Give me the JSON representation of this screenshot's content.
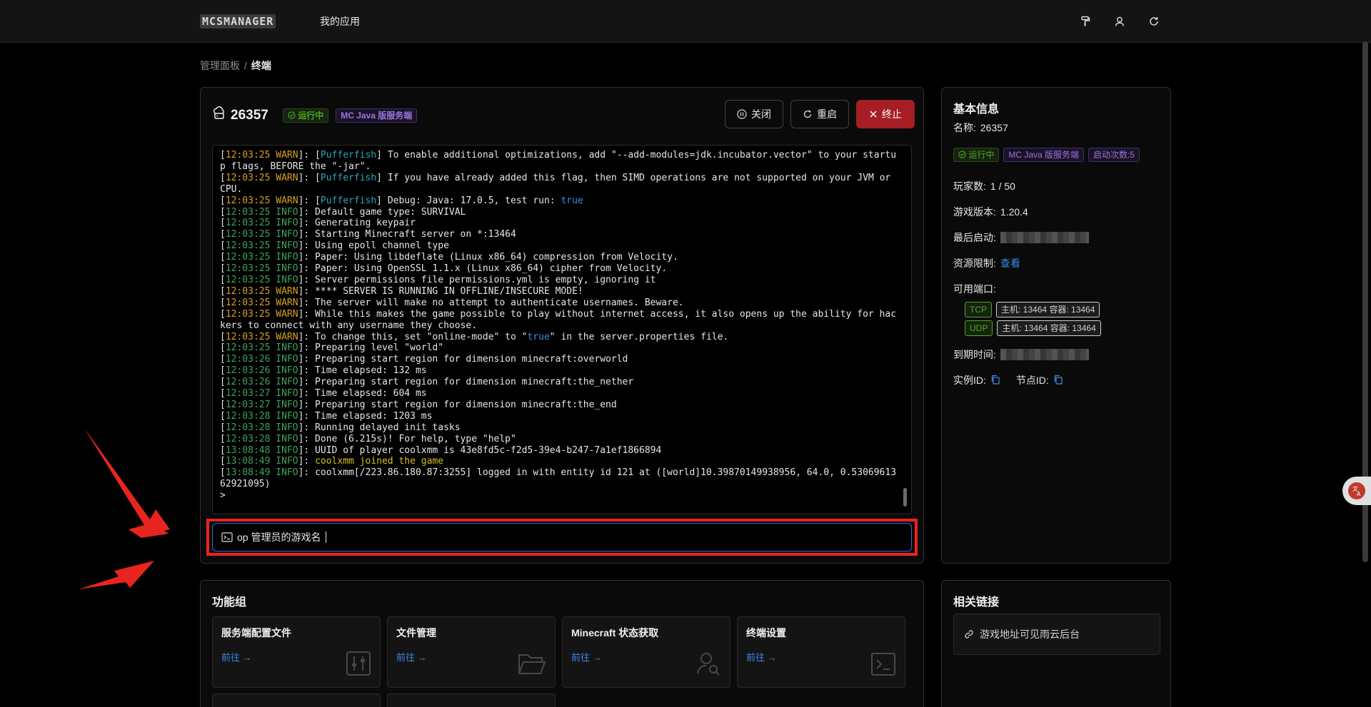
{
  "topbar": {
    "logo": "MCSMANAGER",
    "nav_apps": "我的应用",
    "icons": [
      "paint-roller-icon",
      "user-icon",
      "refresh-icon"
    ]
  },
  "breadcrumb": {
    "root": "管理面板",
    "sep": "/",
    "current": "终端"
  },
  "instance": {
    "name": "26357",
    "status": "运行中",
    "type": "MC Java 版服务端",
    "buttons": {
      "close": "关闭",
      "restart": "重启",
      "kill": "终止"
    }
  },
  "terminal": {
    "lines": [
      [
        [
          "[",
          ""
        ],
        [
          "12:03:25 WARN",
          "warn"
        ],
        [
          "]: [",
          ""
        ],
        [
          "Pufferfish",
          "plugin"
        ],
        [
          "] To enable additional optimizations, add \"",
          ""
        ],
        [
          "--add-modules=jdk.incubator.vector",
          "str"
        ],
        [
          "\" to your startup flags, BEFORE the \"",
          ""
        ],
        [
          "-jar",
          "str"
        ],
        [
          "\".",
          ""
        ]
      ],
      [
        [
          "[",
          ""
        ],
        [
          "12:03:25 WARN",
          "warn"
        ],
        [
          "]: [",
          ""
        ],
        [
          "Pufferfish",
          "plugin"
        ],
        [
          "] If you have already added this flag, then SIMD operations are not supported on your JVM or CPU.",
          ""
        ]
      ],
      [
        [
          "[",
          ""
        ],
        [
          "12:03:25 WARN",
          "warn"
        ],
        [
          "]: [",
          ""
        ],
        [
          "Pufferfish",
          "plugin"
        ],
        [
          "] Debug: Java: 17.0.5, test run: ",
          ""
        ],
        [
          "true",
          "bool"
        ]
      ],
      [
        [
          "[",
          ""
        ],
        [
          "12:03:25 INFO",
          "info"
        ],
        [
          "]: Default game type: SURVIVAL",
          ""
        ]
      ],
      [
        [
          "[",
          ""
        ],
        [
          "12:03:25 INFO",
          "info"
        ],
        [
          "]: Generating keypair",
          ""
        ]
      ],
      [
        [
          "[",
          ""
        ],
        [
          "12:03:25 INFO",
          "info"
        ],
        [
          "]: Starting Minecraft server on *:13464",
          ""
        ]
      ],
      [
        [
          "[",
          ""
        ],
        [
          "12:03:25 INFO",
          "info"
        ],
        [
          "]: Using epoll channel type",
          ""
        ]
      ],
      [
        [
          "[",
          ""
        ],
        [
          "12:03:25 INFO",
          "info"
        ],
        [
          "]: Paper: Using libdeflate (Linux x86_64) compression from Velocity.",
          ""
        ]
      ],
      [
        [
          "[",
          ""
        ],
        [
          "12:03:25 INFO",
          "info"
        ],
        [
          "]: Paper: Using OpenSSL 1.1.x (Linux x86_64) cipher from Velocity.",
          ""
        ]
      ],
      [
        [
          "[",
          ""
        ],
        [
          "12:03:25 INFO",
          "info"
        ],
        [
          "]: Server permissions file permissions.yml is empty, ignoring it",
          ""
        ]
      ],
      [
        [
          "[",
          ""
        ],
        [
          "12:03:25 WARN",
          "warn"
        ],
        [
          "]: **** SERVER IS RUNNING IN OFFLINE/INSECURE MODE!",
          ""
        ]
      ],
      [
        [
          "[",
          ""
        ],
        [
          "12:03:25 WARN",
          "warn"
        ],
        [
          "]: The server will make no attempt to authenticate usernames. Beware.",
          ""
        ]
      ],
      [
        [
          "[",
          ""
        ],
        [
          "12:03:25 WARN",
          "warn"
        ],
        [
          "]: While this makes the game possible to play without internet access, it also opens up the ability for hackers to connect with any username they choose.",
          ""
        ]
      ],
      [
        [
          "[",
          ""
        ],
        [
          "12:03:25 WARN",
          "warn"
        ],
        [
          "]: To change this, set \"",
          ""
        ],
        [
          "online-mode",
          "str"
        ],
        [
          "\" to \"",
          ""
        ],
        [
          "true",
          "bool"
        ],
        [
          "\" in the server.properties file.",
          ""
        ]
      ],
      [
        [
          "[",
          ""
        ],
        [
          "12:03:25 INFO",
          "info"
        ],
        [
          "]: Preparing level \"",
          ""
        ],
        [
          "world",
          "str"
        ],
        [
          "\"",
          ""
        ]
      ],
      [
        [
          "[",
          ""
        ],
        [
          "12:03:26 INFO",
          "info"
        ],
        [
          "]: Preparing start region for dimension minecraft:overworld",
          ""
        ]
      ],
      [
        [
          "[",
          ""
        ],
        [
          "12:03:26 INFO",
          "info"
        ],
        [
          "]: Time elapsed: 132 ms",
          ""
        ]
      ],
      [
        [
          "[",
          ""
        ],
        [
          "12:03:26 INFO",
          "info"
        ],
        [
          "]: Preparing start region for dimension minecraft:the_nether",
          ""
        ]
      ],
      [
        [
          "[",
          ""
        ],
        [
          "12:03:27 INFO",
          "info"
        ],
        [
          "]: Time elapsed: 604 ms",
          ""
        ]
      ],
      [
        [
          "[",
          ""
        ],
        [
          "12:03:27 INFO",
          "info"
        ],
        [
          "]: Preparing start region for dimension minecraft:the_end",
          ""
        ]
      ],
      [
        [
          "[",
          ""
        ],
        [
          "12:03:28 INFO",
          "info"
        ],
        [
          "]: Time elapsed: 1203 ms",
          ""
        ]
      ],
      [
        [
          "[",
          ""
        ],
        [
          "12:03:28 INFO",
          "info"
        ],
        [
          "]: Running delayed init tasks",
          ""
        ]
      ],
      [
        [
          "[",
          ""
        ],
        [
          "12:03:28 INFO",
          "info"
        ],
        [
          "]: Done (6.215s)! For help, type \"",
          ""
        ],
        [
          "help",
          "str"
        ],
        [
          "\"",
          ""
        ]
      ],
      [
        [
          "[",
          ""
        ],
        [
          "13:08:48 INFO",
          "info"
        ],
        [
          "]: UUID of player coolxmm is 43e8fd5c-f2d5-39e4-b247-7a1ef1866894",
          ""
        ]
      ],
      [
        [
          "[",
          ""
        ],
        [
          "13:08:49 INFO",
          "info"
        ],
        [
          "]: ",
          ""
        ],
        [
          "coolxmm joined the game",
          "join"
        ]
      ],
      [
        [
          "[",
          ""
        ],
        [
          "13:08:49 INFO",
          "info"
        ],
        [
          "]: coolxmm[/223.86.180.87:3255] logged in with entity id 121 at ([world]10.39870149938956, 64.0, 0.5306961362921095)",
          ""
        ]
      ],
      [
        [
          ">",
          ""
        ]
      ]
    ]
  },
  "command_input": {
    "value": "op 管理员的游戏名"
  },
  "info": {
    "title": "基本信息",
    "name_label": "名称:",
    "name_value": "26357",
    "status": "运行中",
    "type": "MC Java 版服务端",
    "start_count": "启动次数:5",
    "players_label": "玩家数:",
    "players_value": "1 / 50",
    "version_label": "游戏版本:",
    "version_value": "1.20.4",
    "last_start_label": "最后启动:",
    "resource_label": "资源限制:",
    "resource_link": "查看",
    "ports_label": "可用端口:",
    "ports": [
      {
        "proto": "TCP",
        "detail": "主机: 13464 容器: 13464"
      },
      {
        "proto": "UDP",
        "detail": "主机: 13464 容器: 13464"
      }
    ],
    "expire_label": "到期时间:",
    "instance_id_label": "实例ID:",
    "node_id_label": "节点ID:"
  },
  "functions": {
    "title": "功能组",
    "go_label": "前往 →",
    "items": [
      {
        "title": "服务端配置文件",
        "icon": "sliders-icon"
      },
      {
        "title": "文件管理",
        "icon": "folder-open-icon"
      },
      {
        "title": "Minecraft 状态获取",
        "icon": "user-search-icon"
      },
      {
        "title": "终端设置",
        "icon": "terminal-icon"
      }
    ]
  },
  "links": {
    "title": "相关链接",
    "items": [
      {
        "text": "游戏地址可见雨云后台",
        "icon": "link-icon"
      }
    ]
  },
  "colors": {
    "danger": "#a61d24",
    "highlight": "#e8241f",
    "accent": "#3c89e8",
    "running": "#49aa19"
  }
}
